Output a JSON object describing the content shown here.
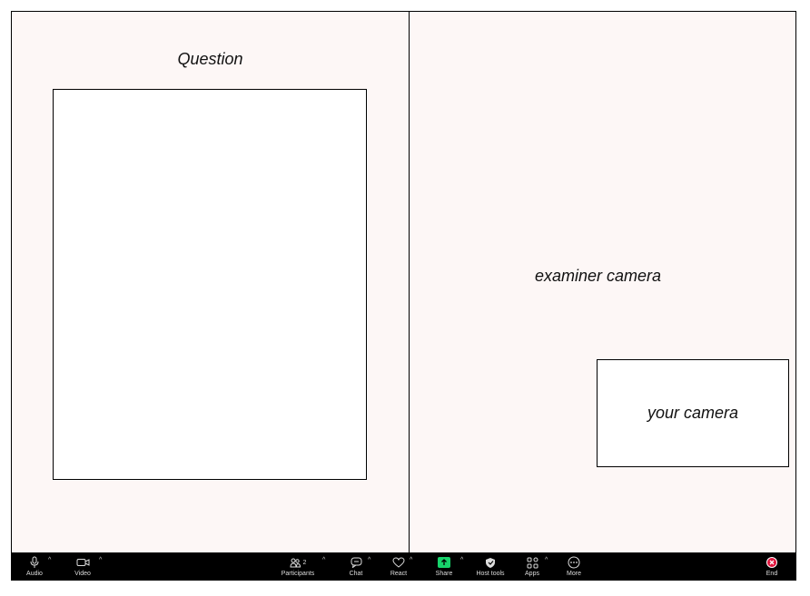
{
  "question": {
    "title": "Question"
  },
  "examiner": {
    "label": "examiner camera"
  },
  "self": {
    "label": "your camera"
  },
  "toolbar": {
    "audio": "Audio",
    "video": "Video",
    "participants": "Participants",
    "participants_count": "2",
    "chat": "Chat",
    "react": "React",
    "share": "Share",
    "host_tools": "Host tools",
    "apps": "Apps",
    "more": "More",
    "end": "End"
  },
  "colors": {
    "share": "#17d46b",
    "end": "#e0143c",
    "panel": "#fdf7f6"
  }
}
